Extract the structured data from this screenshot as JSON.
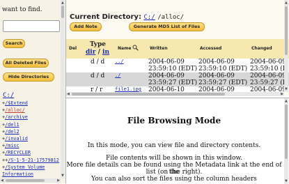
{
  "left": {
    "find_text": "want to find.",
    "search_button": "Search",
    "all_deleted_button": "All Deleted Files",
    "hide_dirs_button": "Hide Directories",
    "tree_root": "C:/",
    "tree": [
      {
        "prefix": "+",
        "label": "/$Extend"
      },
      {
        "prefix": "+",
        "label": "/alloc/",
        "selected": true
      },
      {
        "prefix": "+",
        "label": "/archive"
      },
      {
        "prefix": "+",
        "label": "/del1"
      },
      {
        "prefix": "+",
        "label": "/del2"
      },
      {
        "prefix": "+",
        "label": "/invalid"
      },
      {
        "prefix": "+",
        "label": "/misc"
      },
      {
        "prefix": "+",
        "label": "/RECYCLER"
      },
      {
        "prefix": "++",
        "label": "/S-1-5-21-17579812"
      },
      {
        "prefix": "+",
        "label": "/System Volume"
      },
      {
        "prefix": "",
        "label": "Information"
      }
    ]
  },
  "header": {
    "current_dir_label": "Current Directory:",
    "current_dir_root": "C:/",
    "current_dir_path": "/alloc/",
    "add_note_button": "Add Note",
    "generate_md5_button": "Generate MD5 List of Files"
  },
  "table": {
    "col_del": "Del",
    "col_type": "Type",
    "col_type_sub_dir": "dir",
    "col_type_sub_sep": "/",
    "col_type_sub_in": "in",
    "col_name": "Name",
    "col_written": "Written",
    "col_accessed": "Accessed",
    "col_changed": "Changed",
    "rows": [
      {
        "type": "d / d",
        "name": "../",
        "written": "2004-06-09",
        "written_time": "23:59:10 (EDT)",
        "accessed": "2004-06-09",
        "accessed_time": "23:59:10 (EDT)",
        "changed": "2004-06-09",
        "changed_time": "23:59:10 (E"
      },
      {
        "type": "d / d",
        "name": "./",
        "written": "2004-06-09",
        "written_time": "23:59:27 (EDT)",
        "accessed": "2004-06-09",
        "accessed_time": "23:59:27 (EDT)",
        "changed": "2004-06-09",
        "changed_time": "23:59:27 (E"
      },
      {
        "type": "r / r",
        "name": "file1.jpg",
        "written": "2004-06-10",
        "written_time": "",
        "accessed": "2004-06-09",
        "accessed_time": "",
        "changed": "2004-06-09",
        "changed_time": ""
      }
    ]
  },
  "mode": {
    "title": "File Browsing Mode",
    "line1": "In this mode, you can view file and directory contents.",
    "line2": "File contents will be shown in this window.",
    "line3": "More file details can be found using the Metadata link at the end of the",
    "line4": "list (on the right).",
    "line5": "You can also sort the files using the column headers"
  }
}
